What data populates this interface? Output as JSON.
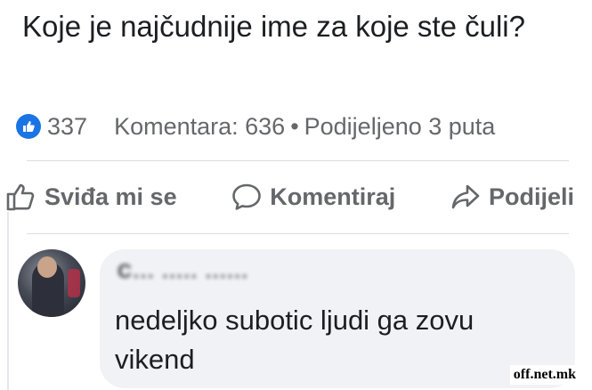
{
  "post": {
    "title": "Koje je najčudnije ime za koje ste čuli?"
  },
  "stats": {
    "reaction_icon": "like-icon",
    "reactions_count": "337",
    "comments": "Komentara: 636",
    "separator": "•",
    "shares": "Podijeljeno 3 puta"
  },
  "actions": {
    "like_label": "Sviđa mi se",
    "comment_label": "Komentiraj",
    "share_label": "Podijeli"
  },
  "comment": {
    "author": "C... ..... ......",
    "text": "nedeljko subotic ljudi ga zovu vikend"
  },
  "watermark": "off.net.mk",
  "colors": {
    "accent": "#1b74e4",
    "muted_text": "#65676b",
    "bubble_bg": "#f0f2f5"
  }
}
